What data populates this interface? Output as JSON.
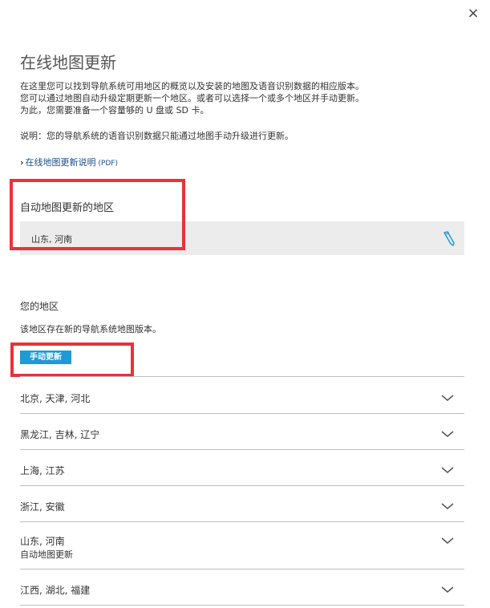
{
  "dialog": {
    "close_label": "×",
    "title": "在线地图更新",
    "description_lines": [
      "在这里您可以找到导航系统可用地区的概览以及安装的地图及语音识别数据的相应版本。",
      "您可以通过地图自动升级定期更新一个地区。或者可以选择一个或多个地区并手动更新。",
      "为此，您需要准备一个容量够的 U 盘或 SD 卡。"
    ],
    "note": "说明：您的导航系统的语音识别数据只能通过地图手动升级进行更新。",
    "pdf_link": {
      "chevron": "›",
      "label": "在线地图更新说明",
      "suffix": " (PDF)"
    }
  },
  "auto_update": {
    "heading": "自动地图更新的地区",
    "value": "山东, 河南",
    "edit_icon": "pencil-icon"
  },
  "your_regions": {
    "heading": "您的地区",
    "subtitle": "该地区存在新的导航系统地图版本。",
    "manual_button": "手动更新",
    "regions": [
      {
        "name": "北京, 天津, 河北",
        "sub": ""
      },
      {
        "name": "黑龙江, 吉林, 辽宁",
        "sub": ""
      },
      {
        "name": "上海, 江苏",
        "sub": ""
      },
      {
        "name": "浙江, 安徽",
        "sub": ""
      },
      {
        "name": "山东, 河南",
        "sub": "自动地图更新"
      },
      {
        "name": "江西, 湖北, 福建",
        "sub": ""
      }
    ]
  },
  "colors": {
    "accent": "#1e9ad6",
    "highlight_border": "#e8323a",
    "panel_bg": "#ececec",
    "divider": "#bdbdbd"
  }
}
